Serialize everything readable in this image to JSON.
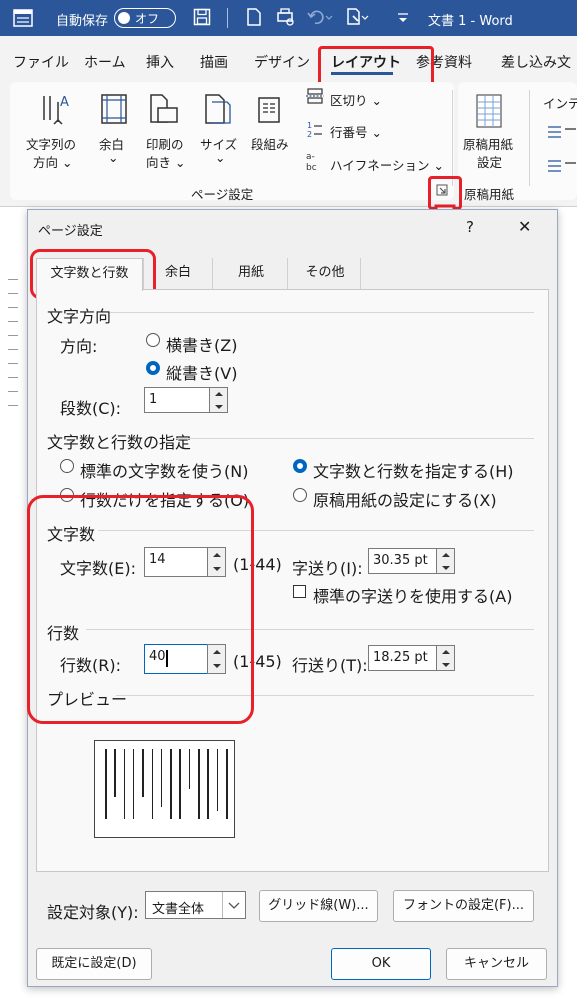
{
  "titlebar": {
    "autosave_label": "自動保存",
    "autosave_state": "オフ",
    "doc_title": "文書 1 - Word",
    "bg_color": "#2b579a"
  },
  "menu": {
    "tabs": [
      "ファイル",
      "ホーム",
      "挿入",
      "描画",
      "デザイン",
      "レイアウト",
      "参考資料",
      "差し込み文"
    ],
    "active_index": 5
  },
  "ribbon": {
    "text_direction": [
      "文字列の",
      "方向 ⌄"
    ],
    "margins": [
      "余白",
      "⌄"
    ],
    "orientation": [
      "印刷の",
      "向き ⌄"
    ],
    "size": [
      "サイズ",
      "⌄"
    ],
    "columns": "段組み",
    "breaks": "区切り ⌄",
    "line_numbers": "行番号 ⌄",
    "hyphenation": "ハイフネーション ⌄",
    "manuscript": [
      "原稿用紙",
      "設定"
    ],
    "indent": "インデ",
    "group_page_setup": "ページ設定",
    "group_manuscript": "原稿用紙"
  },
  "dialog": {
    "title": "ページ設定",
    "help": "?",
    "close": "✕",
    "tabs": [
      "文字数と行数",
      "余白",
      "用紙",
      "その他"
    ],
    "active_tab": 0,
    "text_direction": {
      "heading": "文字方向",
      "direction_label": "方向:",
      "horizontal": "横書き(Z)",
      "vertical": "縦書き(V)",
      "selected": "vertical",
      "columns_label": "段数(C):",
      "columns_value": "1"
    },
    "grid": {
      "heading": "文字数と行数の指定",
      "opt_standard": "標準の文字数を使う(N)",
      "opt_lines_only": "行数だけを指定する(O)",
      "opt_both": "文字数と行数を指定する(H)",
      "opt_manuscript": "原稿用紙の設定にする(X)",
      "selected": "both"
    },
    "chars": {
      "heading": "文字数",
      "label": "文字数(E):",
      "value": "14",
      "range": "(1-44)",
      "pitch_label": "字送り(I):",
      "pitch_value": "30.35 pt",
      "use_standard_pitch": "標準の字送りを使用する(A)",
      "use_standard_pitch_checked": false
    },
    "lines": {
      "heading": "行数",
      "label": "行数(R):",
      "value": "40",
      "range": "(1-45)",
      "pitch_label": "行送り(T):",
      "pitch_value": "18.25 pt"
    },
    "preview": {
      "heading": "プレビュー",
      "line_count": 14
    },
    "apply_to_label": "設定対象(Y):",
    "apply_to_value": "文書全体",
    "grid_button": "グリッド線(W)...",
    "font_button": "フォントの設定(F)...",
    "default_button": "既定に設定(D)",
    "ok_button": "OK",
    "cancel_button": "キャンセル"
  },
  "colors": {
    "accent": "#0067c0",
    "highlight": "#e8202a"
  }
}
